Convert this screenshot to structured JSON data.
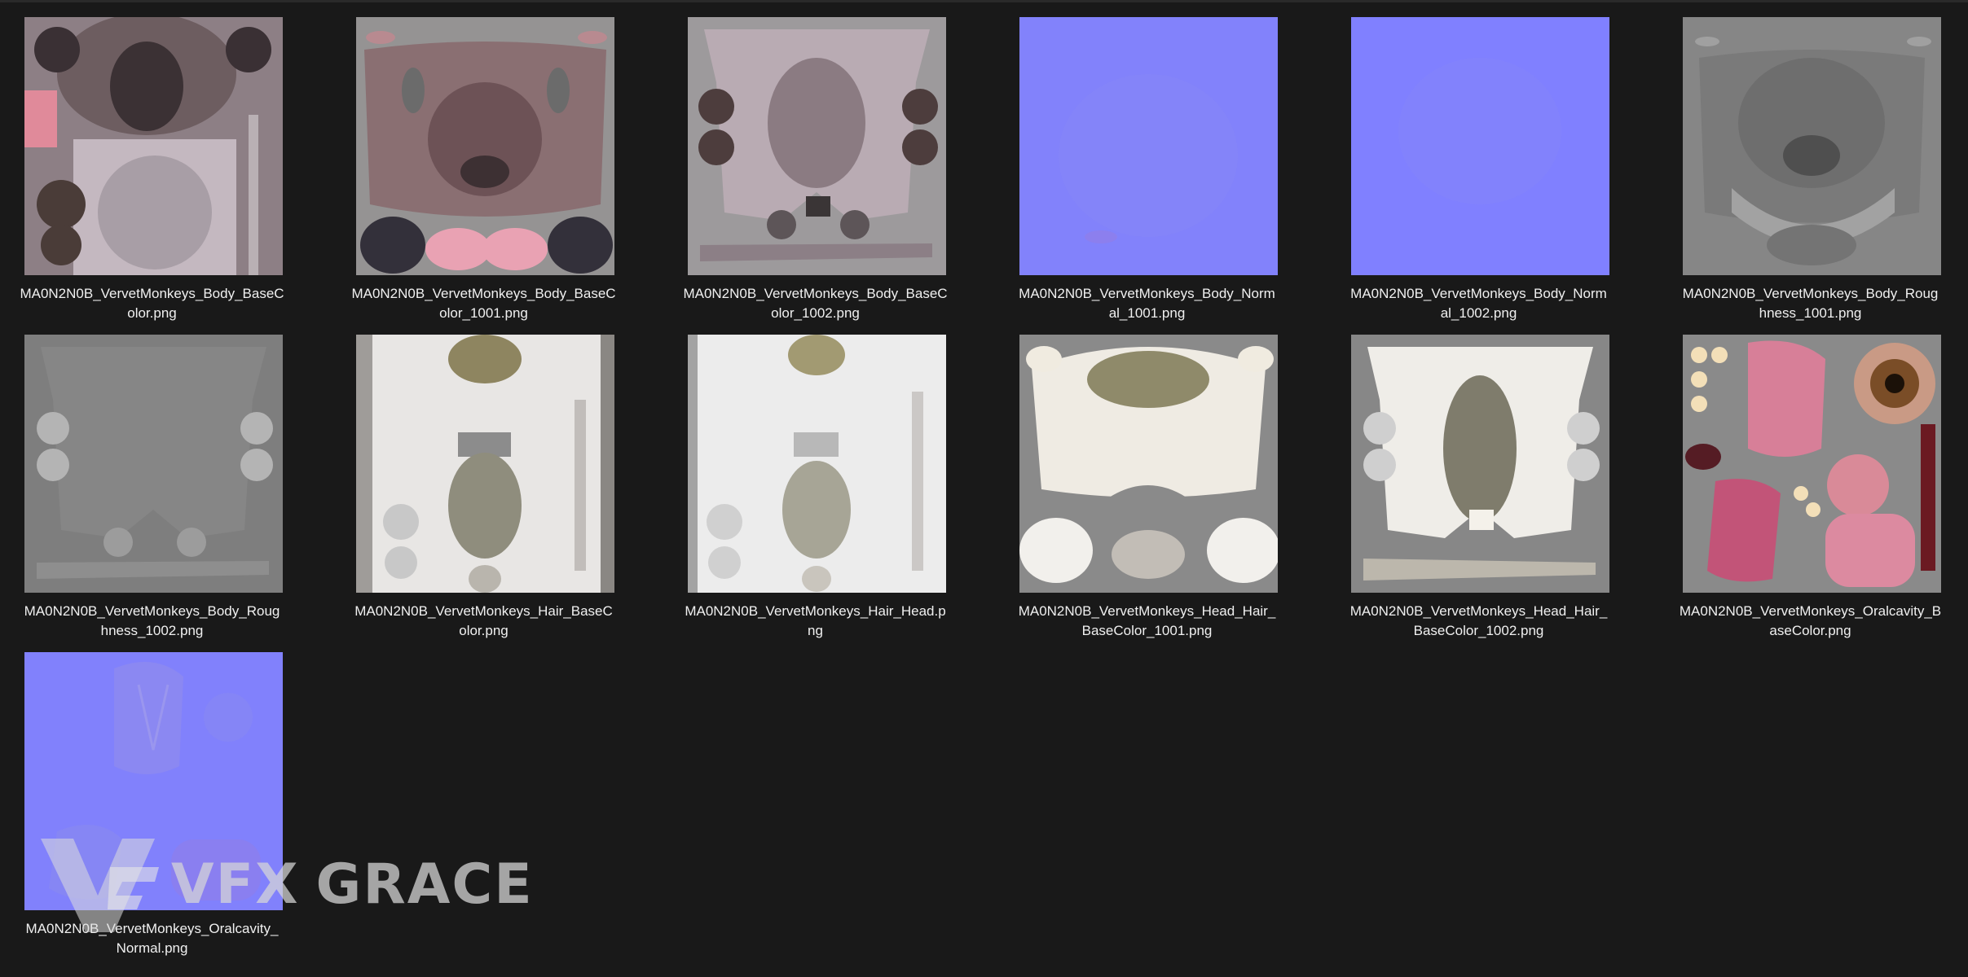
{
  "files": [
    {
      "line1": "MA0N2N0B_VervetMonkeys_Body_BaseC",
      "line2": "olor.png"
    },
    {
      "line1": "MA0N2N0B_VervetMonkeys_Body_BaseC",
      "line2": "olor_1001.png"
    },
    {
      "line1": "MA0N2N0B_VervetMonkeys_Body_BaseC",
      "line2": "olor_1002.png"
    },
    {
      "line1": "MA0N2N0B_VervetMonkeys_Body_Norm",
      "line2": "al_1001.png"
    },
    {
      "line1": "MA0N2N0B_VervetMonkeys_Body_Norm",
      "line2": "al_1002.png"
    },
    {
      "line1": "MA0N2N0B_VervetMonkeys_Body_Roug",
      "line2": "hness_1001.png"
    },
    {
      "line1": "MA0N2N0B_VervetMonkeys_Body_Roug",
      "line2": "hness_1002.png"
    },
    {
      "line1": "MA0N2N0B_VervetMonkeys_Hair_BaseC",
      "line2": "olor.png"
    },
    {
      "line1": "MA0N2N0B_VervetMonkeys_Hair_Head.p",
      "line2": "ng"
    },
    {
      "line1": "MA0N2N0B_VervetMonkeys_Head_Hair_",
      "line2": "BaseColor_1001.png"
    },
    {
      "line1": "MA0N2N0B_VervetMonkeys_Head_Hair_",
      "line2": "BaseColor_1002.png"
    },
    {
      "line1": "MA0N2N0B_VervetMonkeys_Oralcavity_B",
      "line2": "aseColor.png"
    },
    {
      "line1": "MA0N2N0B_VervetMonkeys_Oralcavity_",
      "line2": "Normal.png"
    }
  ],
  "watermark": {
    "word1": "VFX",
    "word2": "GRACE"
  },
  "colors": {
    "background": "#191919",
    "normal_map": "#8080ff",
    "neutral_grey": "#8a8a8a",
    "skin_pink": "#d98a9a"
  }
}
